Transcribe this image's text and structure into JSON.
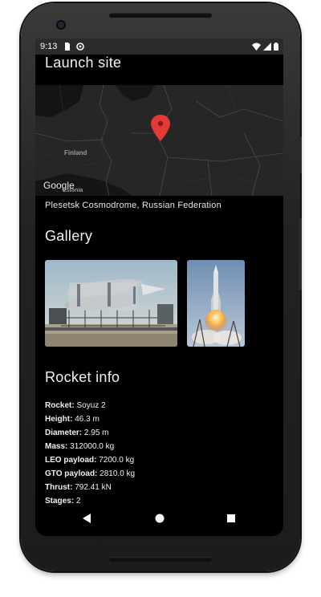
{
  "status_bar": {
    "time": "9:13",
    "icons": [
      "sim-card-icon",
      "sync-icon",
      "wifi-icon",
      "signal-icon",
      "battery-icon"
    ]
  },
  "launch_site": {
    "title": "Launch site",
    "map": {
      "labels": [
        "Finland",
        "Estonia"
      ],
      "attribution": "Google",
      "marker_icon": "map-pin-icon"
    },
    "site_name": "Plesetsk Cosmodrome, Russian Federation"
  },
  "gallery": {
    "title": "Gallery",
    "images": [
      {
        "description": "rocket-on-transporter-image"
      },
      {
        "description": "rocket-launch-image"
      }
    ]
  },
  "rocket_info": {
    "title": "Rocket info",
    "rows": [
      {
        "label": "Rocket:",
        "value": "Soyuz 2"
      },
      {
        "label": "Height:",
        "value": "46.3 m"
      },
      {
        "label": "Diameter:",
        "value": "2.95 m"
      },
      {
        "label": "Mass:",
        "value": "312000.0 kg"
      },
      {
        "label": "LEO payload:",
        "value": "7200.0 kg"
      },
      {
        "label": "GTO payload:",
        "value": "2810.0 kg"
      },
      {
        "label": "Thrust:",
        "value": "792.41 kN"
      },
      {
        "label": "Stages:",
        "value": "2"
      }
    ]
  },
  "nav_bar": {
    "buttons": [
      "back-icon",
      "home-icon",
      "recents-icon"
    ]
  },
  "colors": {
    "background": "#000000",
    "status_bar": "#2b2b2b",
    "map_background": "#232323",
    "map_marker": "#e53935",
    "text": "#f0f0f0"
  }
}
